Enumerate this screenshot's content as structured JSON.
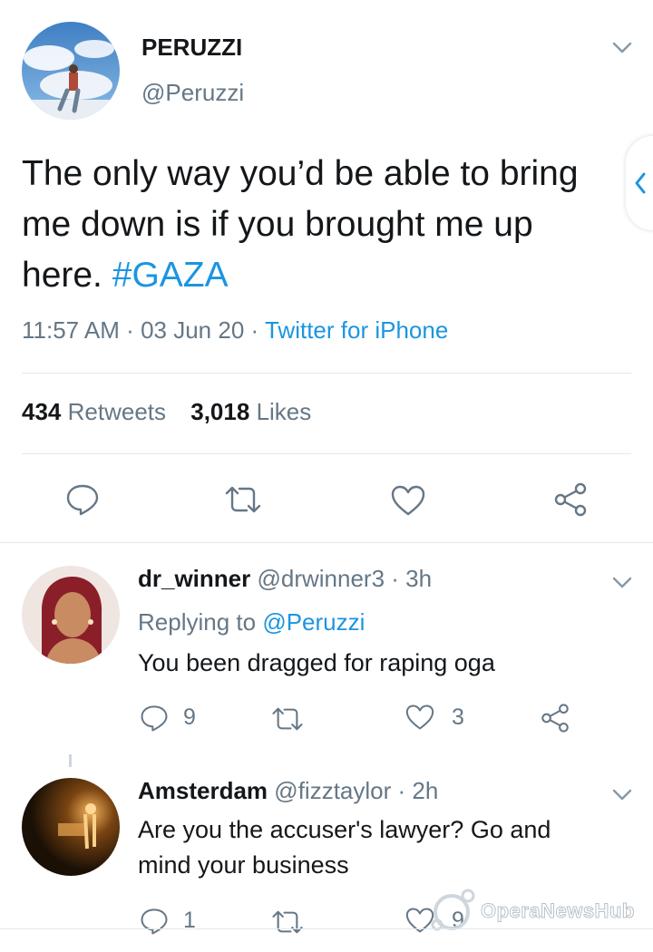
{
  "main_tweet": {
    "author_name": "PERUZZI",
    "author_handle": "@Peruzzi",
    "text": "The only way you’d be able to bring me down is if you brought me up here.",
    "hashtag": "#GAZA",
    "time": "11:57 AM",
    "dot1": "·",
    "date": "03 Jun 20",
    "dot2": "·",
    "source": "Twitter for iPhone",
    "retweets_count": "434",
    "retweets_label": "Retweets",
    "likes_count": "3,018",
    "likes_label": "Likes"
  },
  "replies": [
    {
      "name": "dr_winner",
      "handle_time": "@drwinner3 · 3h",
      "replying_prefix": "Replying to",
      "replying_to": "@Peruzzi",
      "text": "You been dragged for raping oga",
      "reply_count": "9",
      "like_count": "3"
    },
    {
      "name": "Amsterdam",
      "handle_time": "@fizztaylor · 2h",
      "text": "Are you the accuser's lawyer? Go and mind your business",
      "reply_count": "1",
      "like_count": "9"
    }
  ],
  "watermark": {
    "text": "OperaNewsHub"
  },
  "colors": {
    "accent": "#1b95e0",
    "secondary_text": "#657786",
    "divider": "#e1e8ed"
  }
}
